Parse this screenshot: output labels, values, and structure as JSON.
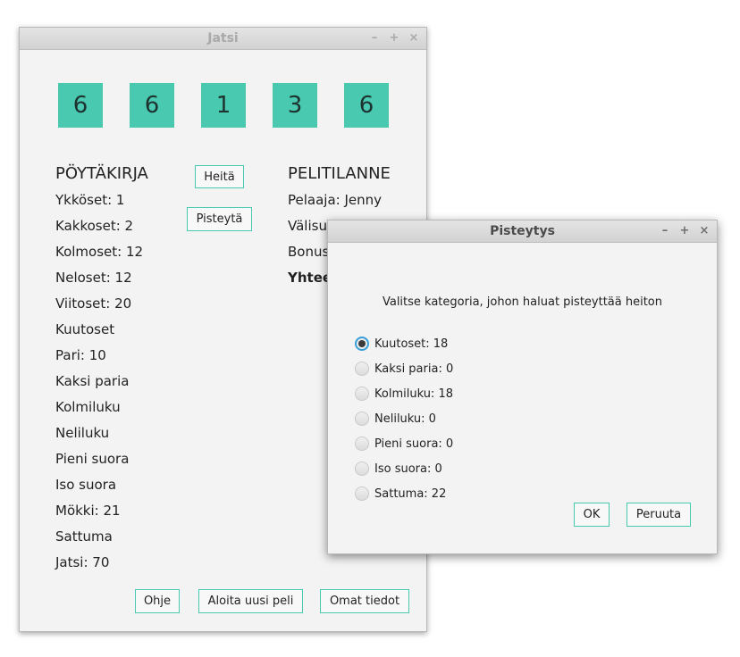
{
  "main_window": {
    "title": "Jatsi",
    "controls": {
      "minimize": "–",
      "maximize": "+",
      "close": "×"
    },
    "dice": [
      "6",
      "6",
      "1",
      "3",
      "6"
    ],
    "buttons": {
      "throw": "Heitä",
      "score": "Pisteytä"
    },
    "scorecard": {
      "heading": "PÖYTÄKIRJA",
      "rows": [
        "Ykköset: 1",
        "Kakkoset: 2",
        "Kolmoset: 12",
        "Neloset: 12",
        "Viitoset: 20",
        "Kuutoset",
        "Pari: 10",
        "Kaksi paria",
        "Kolmiluku",
        "Neliluku",
        "Pieni suora",
        "Iso suora",
        "Mökki: 21",
        "Sattuma",
        "Jatsi: 70"
      ]
    },
    "game_status": {
      "heading": "PELITILANNE",
      "player": "Pelaaja: Jenny",
      "subtotal": "Välisu",
      "bonus": "Bonus",
      "total": "Yhtee"
    },
    "footer": {
      "help": "Ohje",
      "new_game": "Aloita uusi peli",
      "profile": "Omat tiedot"
    }
  },
  "dialog": {
    "title": "Pisteytys",
    "controls": {
      "minimize": "–",
      "maximize": "+",
      "close": "×"
    },
    "prompt": "Valitse kategoria, johon haluat pisteyttää heiton",
    "options": [
      {
        "label": "Kuutoset: 18",
        "selected": true
      },
      {
        "label": "Kaksi paria: 0",
        "selected": false
      },
      {
        "label": "Kolmiluku: 18",
        "selected": false
      },
      {
        "label": "Neliluku: 0",
        "selected": false
      },
      {
        "label": "Pieni suora: 0",
        "selected": false
      },
      {
        "label": "Iso suora: 0",
        "selected": false
      },
      {
        "label": "Sattuma: 22",
        "selected": false
      }
    ],
    "ok": "OK",
    "cancel": "Peruuta"
  },
  "colors": {
    "die_fill": "#48c9b0",
    "button_border": "#48c9b0",
    "radio_focus": "#3a9fd8"
  }
}
